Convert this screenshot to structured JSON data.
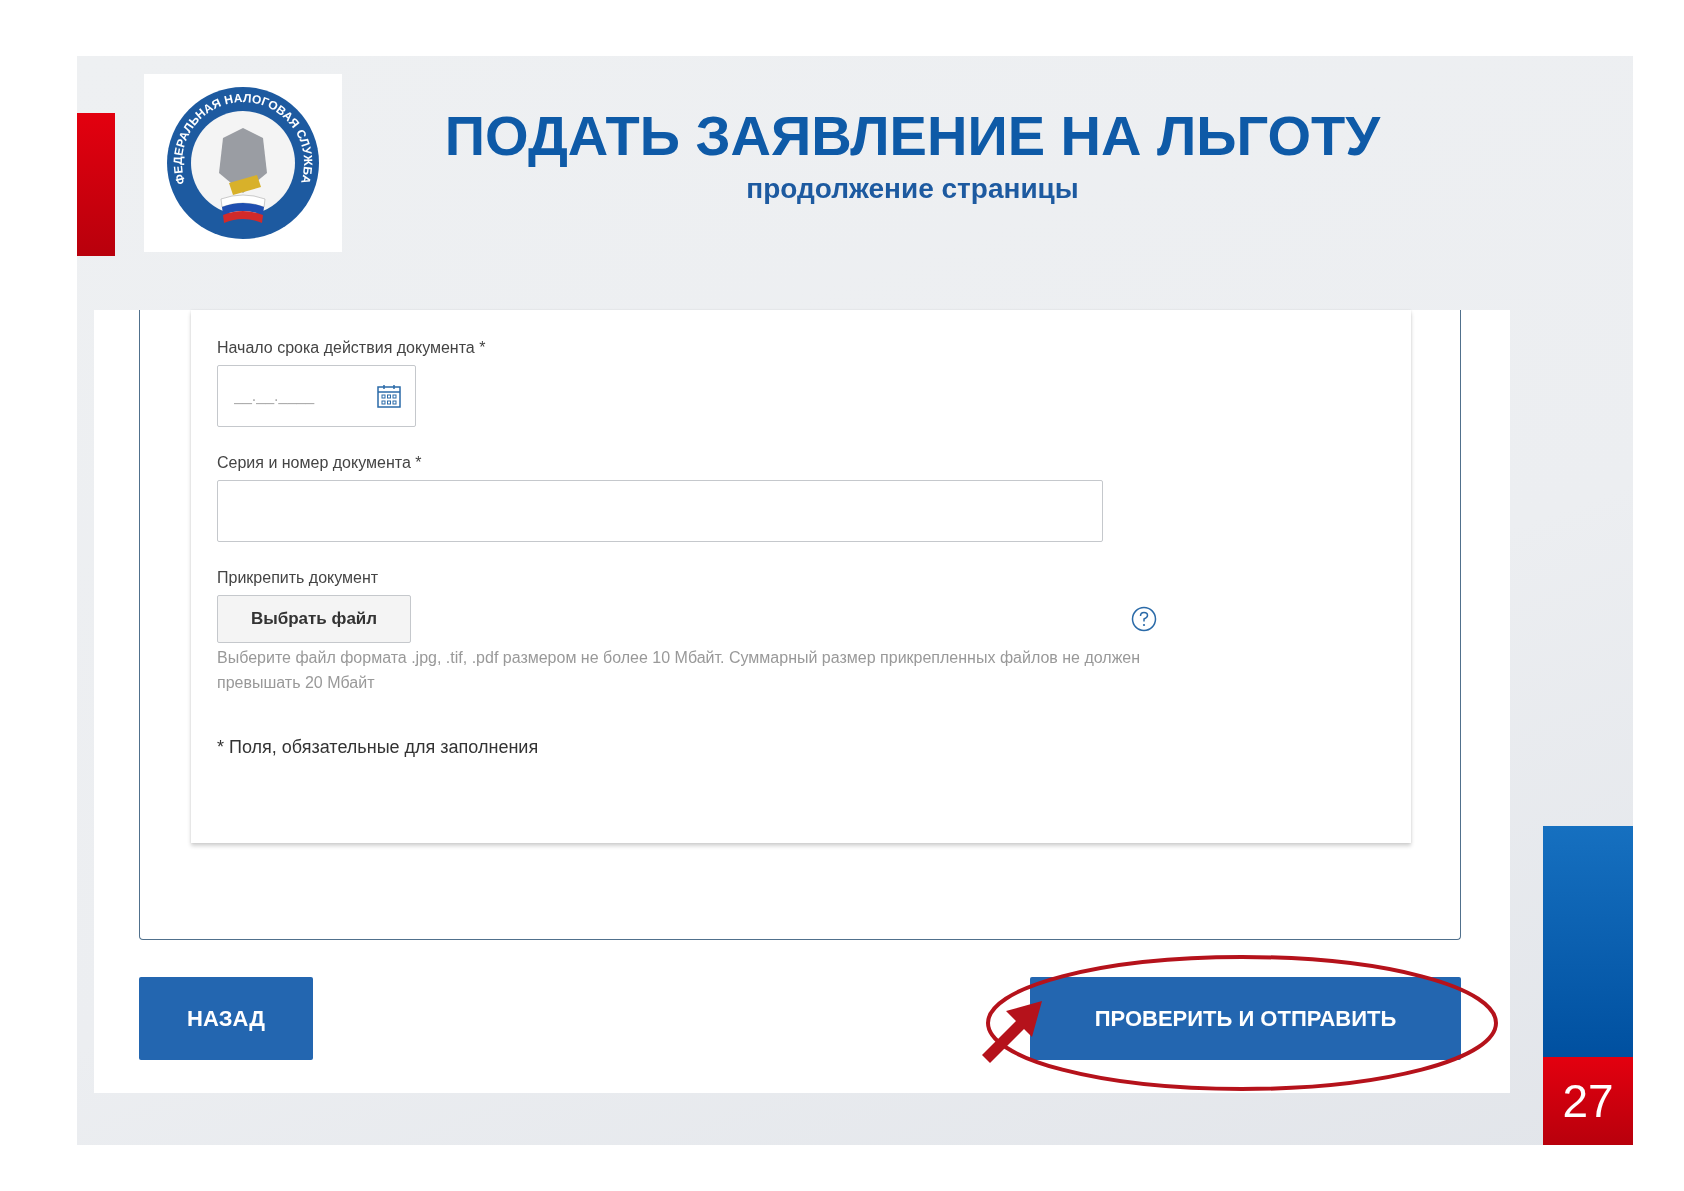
{
  "slide": {
    "logo": {
      "text": "ФЕДЕРАЛЬНАЯ НАЛОГОВАЯ СЛУЖБА"
    },
    "title": "ПОДАТЬ ЗАЯВЛЕНИЕ НА ЛЬГОТУ",
    "subtitle": "продолжение страницы",
    "page_number": "27"
  },
  "form": {
    "fields": [
      {
        "kind": "date",
        "label": "Начало срока действия документа *",
        "placeholder": "__.__.____"
      },
      {
        "kind": "text",
        "label": "Серия и номер документа *"
      },
      {
        "kind": "file",
        "label": "Прикрепить документ",
        "button": "Выбрать файл",
        "hint": "Выберите файл формата .jpg, .tif, .pdf размером не более 10 Мбайт. Суммарный размер прикрепленных файлов не должен превышать 20 Мбайт"
      }
    ],
    "required_note": "* Поля, обязательные для заполнения",
    "buttons": [
      {
        "label": "НАЗАД",
        "highlighted": false
      },
      {
        "label": "ПРОВЕРИТЬ И ОТПРАВИТЬ",
        "highlighted": true
      }
    ]
  }
}
